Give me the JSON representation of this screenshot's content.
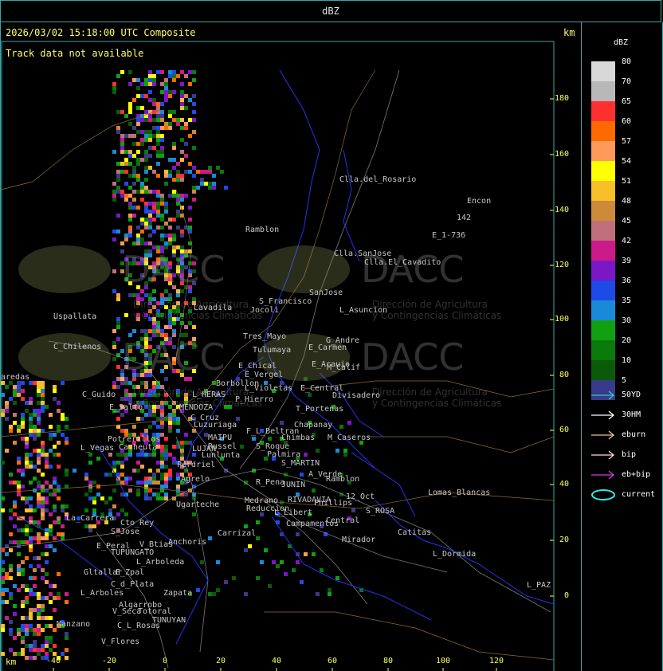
{
  "window": {
    "title": "dBZ"
  },
  "map": {
    "timestamp": "2026/03/02 15:18:00 UTC Composite",
    "unit_label": "km",
    "status_text": "Track data not available",
    "x_axis_label": "km",
    "x_ticks": [
      "-40",
      "-20",
      "0",
      "20",
      "40",
      "60",
      "80",
      "100",
      "120"
    ],
    "y_ticks": [
      "180",
      "160",
      "140",
      "120",
      "100",
      "80",
      "60",
      "40",
      "20",
      "0"
    ],
    "watermark": {
      "brand": "DACC",
      "subtitle_1": "Dirección de Agricultura",
      "subtitle_2": "y Contingencias Climáticas"
    },
    "towns": [
      "Clla.del_Rosario",
      "Encon",
      "142",
      "E_1-736",
      "Ramblon",
      "Clla.SanJose",
      "Clla.El_Cavadito",
      "Uspallata",
      "S_Francisco",
      "SanJose",
      "L_Asuncion",
      "Lavadila",
      "Jocoli",
      "C_Chilenos",
      "Tres_Mayo",
      "G_Andre",
      "Tulumaya",
      "E_Carmen",
      "E_Chical",
      "E_Arauio",
      "M_Calif",
      "E_Vergel",
      "Borbollon",
      "L_Violetas",
      "E_Central",
      "Divisadero",
      "aredas",
      "C_Guido",
      "L_HERAS",
      "P_Hierro",
      "E_Salto",
      "MENDOZA",
      "T_Portenas",
      "C_Cruz",
      "Luzuriaga",
      "Chapanay",
      "F_L_Beltran",
      "Potrerillos",
      "L_Vegas",
      "Cacheuta",
      "MAIPU",
      "Russel",
      "Chimbas",
      "M_Caseros",
      "LUJAN",
      "S_Roque",
      "Lunlunta",
      "Palmira",
      "S_MARTIN",
      "Perdriel",
      "A_Verde",
      "Ramblon",
      "Agrelo",
      "R_Pena",
      "JUNIN",
      "Ugarteche",
      "Medrano",
      "RIVADAVIA",
      "Phillips",
      "12_Oct",
      "Lomas_Blancas",
      "Reduccion",
      "L_Libert",
      "La_Carrera",
      "S_ROSA",
      "Cto_Rey",
      "Campamentos",
      "Central",
      "S_Jose",
      "Carrizal",
      "Catitas",
      "Anchoris",
      "E_Peral",
      "V_Btias",
      "TUPUNGATO",
      "Mirador",
      "L_Dormida",
      "L_Arboleda",
      "Gltallar",
      "E_Zpal",
      "C_d_Plata",
      "L_Arboles",
      "Zapata",
      "L_PAZ",
      "Algarrobo",
      "V_Seca",
      "Totoral",
      "TUNUYAN",
      "Manzano",
      "C_L_Rosas",
      "V_Flores"
    ]
  },
  "legend": {
    "title": "dBZ",
    "levels": [
      {
        "label": "80",
        "color": "#d8d8d8"
      },
      {
        "label": "70",
        "color": "#b8b8b8"
      },
      {
        "label": "65",
        "color": "#ff3030"
      },
      {
        "label": "60",
        "color": "#ff6a00"
      },
      {
        "label": "57",
        "color": "#ff9a5a"
      },
      {
        "label": "54",
        "color": "#ffff00"
      },
      {
        "label": "51",
        "color": "#f7c02a"
      },
      {
        "label": "48",
        "color": "#cc8a3a"
      },
      {
        "label": "45",
        "color": "#c0707a"
      },
      {
        "label": "42",
        "color": "#cc1a8a"
      },
      {
        "label": "39",
        "color": "#7a18c8"
      },
      {
        "label": "36",
        "color": "#1e4be8"
      },
      {
        "label": "35",
        "color": "#1a8ad8"
      },
      {
        "label": "30",
        "color": "#11a011"
      },
      {
        "label": "20",
        "color": "#0a7a0a"
      },
      {
        "label": "10",
        "color": "#0a5a0a"
      },
      {
        "label": "5",
        "color": "#3a3a8a"
      }
    ],
    "tracks": [
      {
        "label": "50YD",
        "color": "#37c8c8"
      },
      {
        "label": "30HM",
        "color": "#ffffff"
      },
      {
        "label": "eburn",
        "color": "#f5c08a"
      },
      {
        "label": "bip",
        "color": "#ffd8d8"
      },
      {
        "label": "eb+bip",
        "color": "#d040d0"
      },
      {
        "label": "current",
        "color": "#37e8e8"
      }
    ]
  }
}
